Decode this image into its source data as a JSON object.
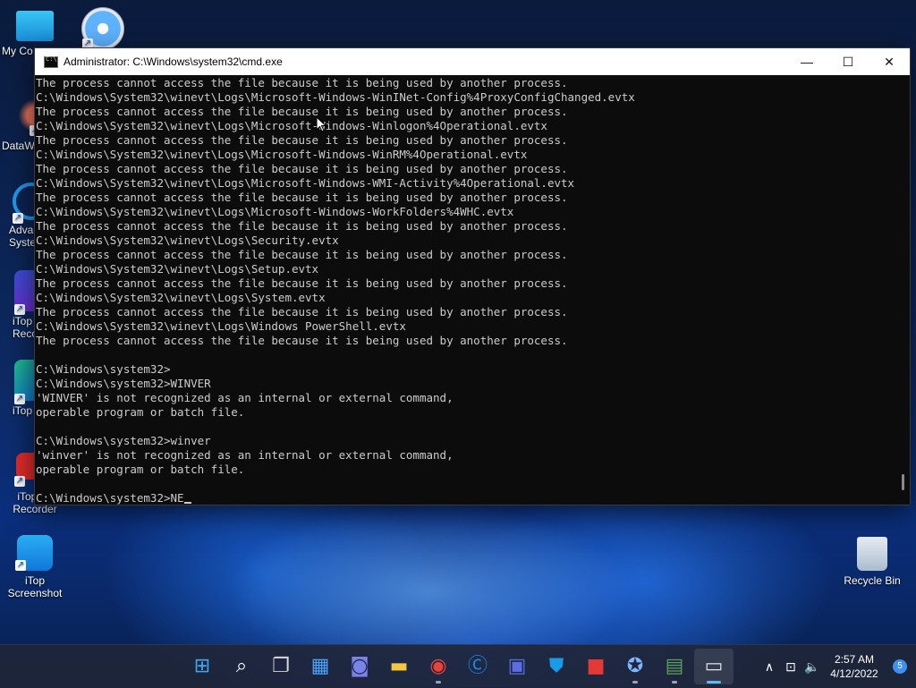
{
  "desktop": {
    "icons_left": [
      {
        "label": "My Co",
        "icon": "computer-icon"
      },
      {
        "label": "DataW",
        "icon": "datawiper-icon"
      },
      {
        "label": "Adva\nSyste",
        "icon": "advanced-systemcare-icon"
      },
      {
        "label": "iTop\nReco",
        "icon": "itop-recorder-icon"
      },
      {
        "label": "iTop",
        "icon": "itop-icon"
      },
      {
        "label": "iTop Sc\nRecorder",
        "icon": "itop-screen-recorder-icon"
      },
      {
        "label": "iTop\nScreenshot",
        "icon": "itop-screenshot-icon"
      }
    ],
    "icon_safari": {
      "icon": "safari-icon"
    },
    "recycle_bin": {
      "label": "Recycle Bin",
      "icon": "recycle-bin-icon"
    }
  },
  "cmd_window": {
    "title": "Administrator: C:\\Windows\\system32\\cmd.exe",
    "controls": {
      "minimize": "—",
      "maximize": "☐",
      "close": "✕"
    },
    "lines": [
      "The process cannot access the file because it is being used by another process.",
      "C:\\Windows\\System32\\winevt\\Logs\\Microsoft-Windows-WinINet-Config%4ProxyConfigChanged.evtx",
      "The process cannot access the file because it is being used by another process.",
      "C:\\Windows\\System32\\winevt\\Logs\\Microsoft-Windows-Winlogon%4Operational.evtx",
      "The process cannot access the file because it is being used by another process.",
      "C:\\Windows\\System32\\winevt\\Logs\\Microsoft-Windows-WinRM%4Operational.evtx",
      "The process cannot access the file because it is being used by another process.",
      "C:\\Windows\\System32\\winevt\\Logs\\Microsoft-Windows-WMI-Activity%4Operational.evtx",
      "The process cannot access the file because it is being used by another process.",
      "C:\\Windows\\System32\\winevt\\Logs\\Microsoft-Windows-WorkFolders%4WHC.evtx",
      "The process cannot access the file because it is being used by another process.",
      "C:\\Windows\\System32\\winevt\\Logs\\Security.evtx",
      "The process cannot access the file because it is being used by another process.",
      "C:\\Windows\\System32\\winevt\\Logs\\Setup.evtx",
      "The process cannot access the file because it is being used by another process.",
      "C:\\Windows\\System32\\winevt\\Logs\\System.evtx",
      "The process cannot access the file because it is being used by another process.",
      "C:\\Windows\\System32\\winevt\\Logs\\Windows PowerShell.evtx",
      "The process cannot access the file because it is being used by another process.",
      "",
      "C:\\Windows\\system32>",
      "C:\\Windows\\system32>WINVER",
      "'WINVER' is not recognized as an internal or external command,",
      "operable program or batch file.",
      "",
      "C:\\Windows\\system32>winver",
      "'winver' is not recognized as an internal or external command,",
      "operable program or batch file.",
      ""
    ],
    "prompt_line": "C:\\Windows\\system32>NE"
  },
  "taskbar": {
    "items": [
      {
        "name": "start-button",
        "icon": "windows-logo-icon",
        "glyph": "⊞",
        "color": "#3fa9f5",
        "active": false
      },
      {
        "name": "search-button",
        "icon": "search-icon",
        "glyph": "⌕",
        "color": "#ffffff",
        "active": false
      },
      {
        "name": "task-view-button",
        "icon": "task-view-icon",
        "glyph": "❐",
        "color": "#d9d9d9",
        "active": false
      },
      {
        "name": "widgets-button",
        "icon": "widgets-icon",
        "glyph": "▦",
        "color": "#4aa3ff",
        "active": false
      },
      {
        "name": "teams-chat-button",
        "icon": "chat-icon",
        "glyph": "◙",
        "color": "#7b83eb",
        "active": false
      },
      {
        "name": "file-explorer-button",
        "icon": "folder-icon",
        "glyph": "▬",
        "color": "#f4c542",
        "active": false
      },
      {
        "name": "chrome-button",
        "icon": "chrome-icon",
        "glyph": "◉",
        "color": "#ea4335",
        "active": false
      },
      {
        "name": "advanced-systemcare-button",
        "icon": "advanced-systemcare-icon",
        "glyph": "Ⓒ",
        "color": "#1e88e5",
        "active": false
      },
      {
        "name": "itop-app-button",
        "icon": "itop-app-icon",
        "glyph": "▣",
        "color": "#5b6ee1",
        "active": false
      },
      {
        "name": "security-app-button",
        "icon": "shield-icon",
        "glyph": "⛊",
        "color": "#1a9be8",
        "active": false
      },
      {
        "name": "screen-recorder-button",
        "icon": "screen-recorder-icon",
        "glyph": "■",
        "color": "#e53935",
        "active": false
      },
      {
        "name": "safari-button",
        "icon": "safari-icon",
        "glyph": "✪",
        "color": "#7fb6ff",
        "active": false
      },
      {
        "name": "green-app-button",
        "icon": "monitor-app-icon",
        "glyph": "▤",
        "color": "#5aa05a",
        "active": false
      },
      {
        "name": "cmd-taskbar-button",
        "icon": "cmd-icon",
        "glyph": "▭",
        "color": "#e0e0e0",
        "active": true
      }
    ],
    "tray": {
      "chevron": "∧",
      "network": "⊡",
      "volume": "🔈",
      "time": "2:57 AM",
      "date": "4/12/2022",
      "notifications": "5"
    }
  }
}
